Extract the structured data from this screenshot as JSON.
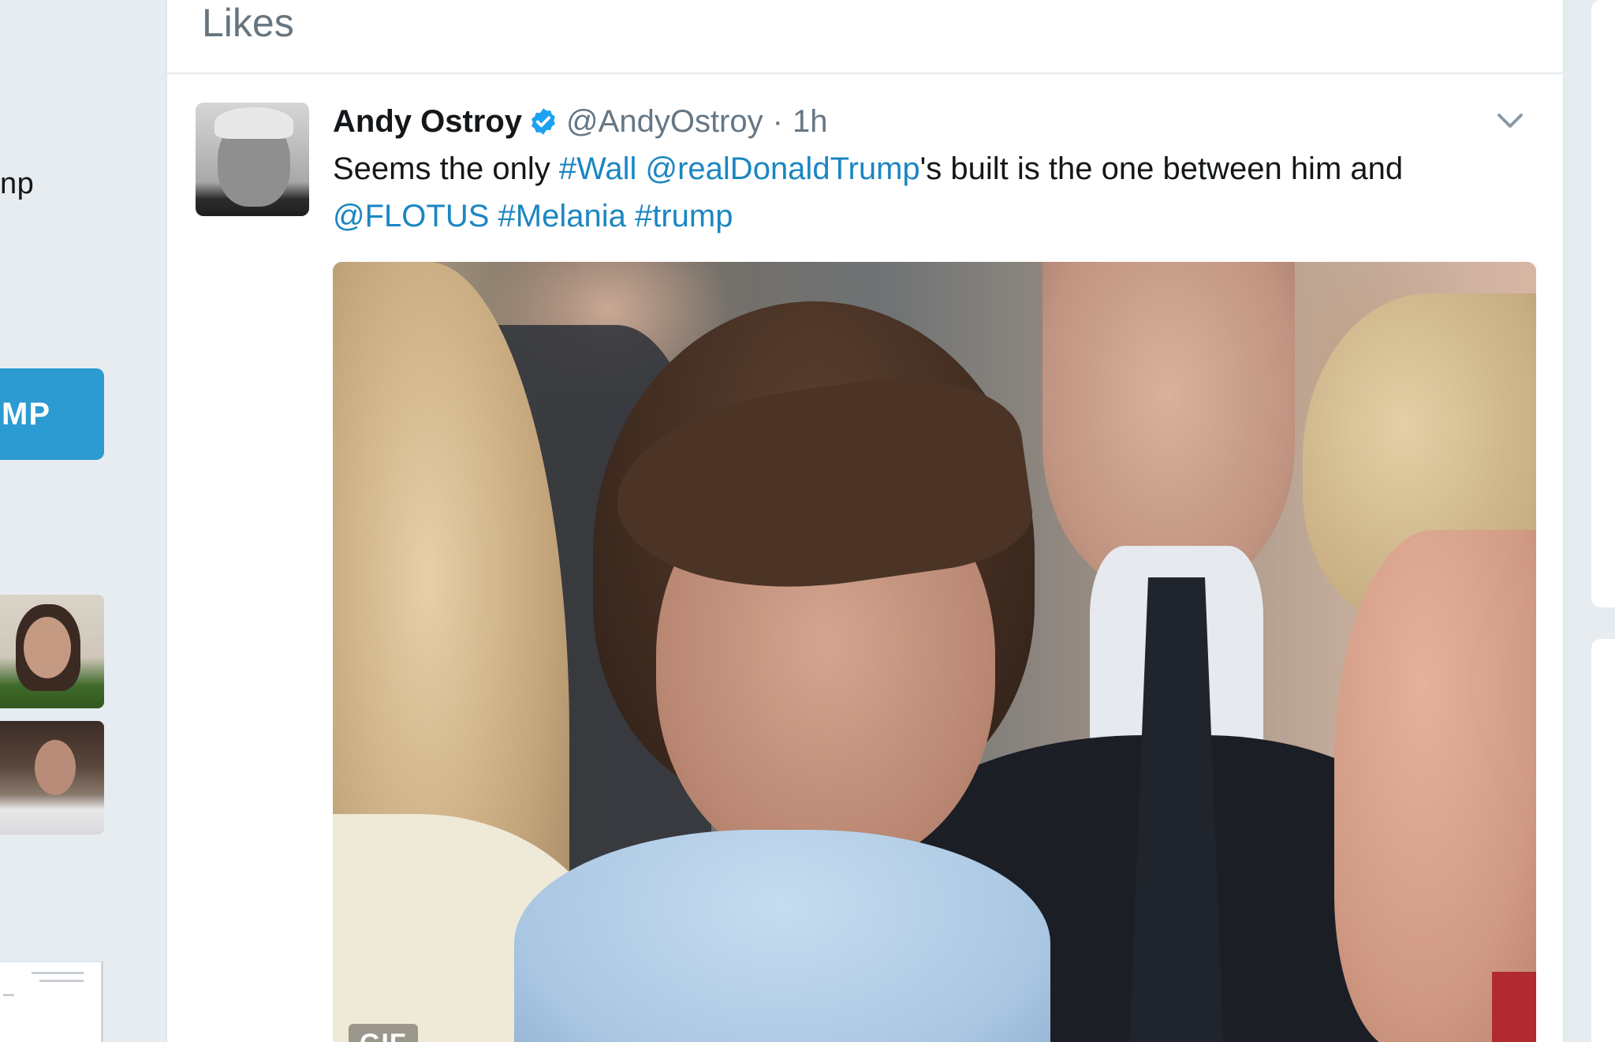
{
  "left_panel": {
    "partial_text": "np",
    "button_label": "MP"
  },
  "section": {
    "title": "Likes"
  },
  "tweet": {
    "author_name": "Andy Ostroy",
    "handle": "@AndyOstroy",
    "separator": "·",
    "time": "1h",
    "text_parts": {
      "p1": "Seems the only ",
      "hashtag_wall": "#Wall",
      "p2": " ",
      "mention_realdonaldtrump": "@realDonaldTrump",
      "p3": "'s built is the one between him and ",
      "mention_flotus": "@FLOTUS",
      "p4": " ",
      "hashtag_melania": "#Melania",
      "p5": " ",
      "hashtag_trump": "#trump"
    },
    "media_badge": "GIF"
  },
  "icons": {
    "verified": "verified-badge-icon",
    "caret": "chevron-down-icon"
  },
  "colors": {
    "link": "#1b86c2",
    "button": "#2b9bd1",
    "background": "#e6ecf0",
    "verified": "#1da1f2"
  }
}
